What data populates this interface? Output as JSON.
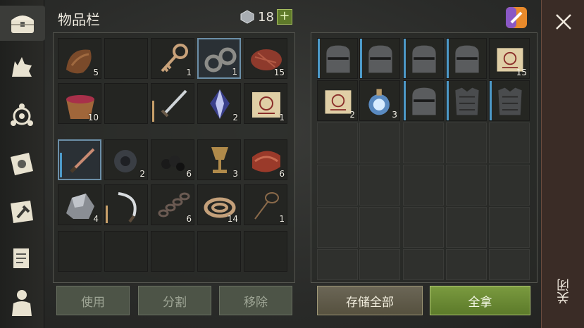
{
  "header": {
    "title": "物品栏",
    "currency_count": "18",
    "add_label": "+"
  },
  "inventory": {
    "rows": [
      [
        {
          "icon": "leather-icon",
          "qty": "5"
        },
        {
          "icon": "",
          "qty": ""
        },
        {
          "icon": "key-icon",
          "qty": "1"
        },
        {
          "icon": "shackles-icon",
          "qty": "1",
          "selected": true
        },
        {
          "icon": "steak-icon",
          "qty": "15"
        }
      ],
      [
        {
          "icon": "berry-bowl-icon",
          "qty": "10"
        },
        {
          "icon": "",
          "qty": ""
        },
        {
          "icon": "sword-icon",
          "qty": "",
          "durability": 0.6
        },
        {
          "icon": "crystal-icon",
          "qty": "2"
        },
        {
          "icon": "scroll-icon",
          "qty": "1"
        }
      ],
      [
        {
          "icon": "knife-icon",
          "qty": "",
          "selected": true,
          "durability": 0.7
        },
        {
          "icon": "gear-part-icon",
          "qty": "2"
        },
        {
          "icon": "coal-icon",
          "qty": "6"
        },
        {
          "icon": "goblet-icon",
          "qty": "3"
        },
        {
          "icon": "meat-strips-icon",
          "qty": "6"
        }
      ],
      [
        {
          "icon": "ore-icon",
          "qty": "4"
        },
        {
          "icon": "sickle-icon",
          "qty": "",
          "durability": 0.5
        },
        {
          "icon": "chain-icon",
          "qty": "6"
        },
        {
          "icon": "rope-icon",
          "qty": "14"
        },
        {
          "icon": "lasso-icon",
          "qty": "1"
        }
      ]
    ],
    "buttons": {
      "use": "使用",
      "split": "分割",
      "remove": "移除"
    }
  },
  "storage": {
    "row1": [
      {
        "icon": "helmet-icon",
        "qty": ""
      },
      {
        "icon": "helmet-icon",
        "qty": ""
      },
      {
        "icon": "helmet-icon",
        "qty": ""
      },
      {
        "icon": "helmet-icon",
        "qty": ""
      },
      {
        "icon": "scroll-icon",
        "qty": "15"
      }
    ],
    "row2": [
      {
        "icon": "scroll-icon",
        "qty": "2"
      },
      {
        "icon": "potion-icon",
        "qty": "3"
      },
      {
        "icon": "helmet-icon",
        "qty": ""
      },
      {
        "icon": "armor-icon",
        "qty": ""
      },
      {
        "icon": "armor-icon",
        "qty": ""
      }
    ],
    "buttons": {
      "store_all": "存储全部",
      "take_all": "全拿"
    }
  },
  "close": {
    "label": "关闭"
  },
  "colors": {
    "accent_green": "#6c8a33",
    "select_blue": "#4d9ac9",
    "durability": "#c8a06a"
  }
}
